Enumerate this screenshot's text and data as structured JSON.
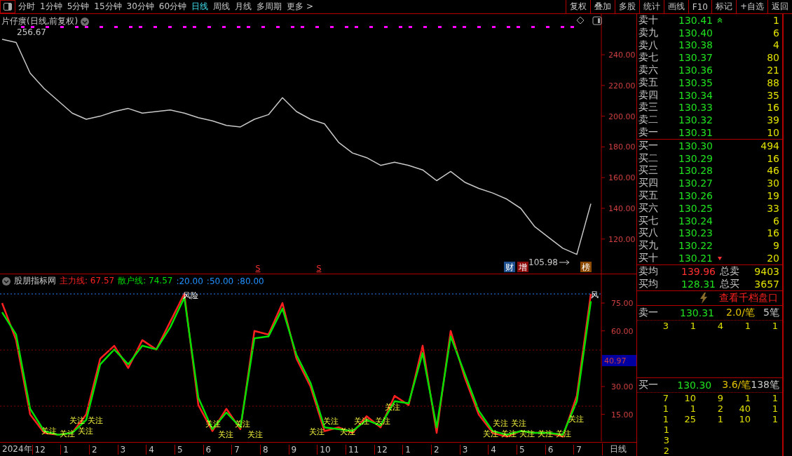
{
  "toolbar": {
    "periods": [
      {
        "label": "分时",
        "selected": false
      },
      {
        "label": "1分钟",
        "selected": false
      },
      {
        "label": "5分钟",
        "selected": false
      },
      {
        "label": "15分钟",
        "selected": false
      },
      {
        "label": "30分钟",
        "selected": false
      },
      {
        "label": "60分钟",
        "selected": false
      },
      {
        "label": "日线",
        "selected": true
      },
      {
        "label": "周线",
        "selected": false
      },
      {
        "label": "月线",
        "selected": false
      },
      {
        "label": "多周期",
        "selected": false
      },
      {
        "label": "更多 >",
        "selected": false
      }
    ],
    "buttons": [
      "复权",
      "叠加",
      "多股",
      "统计",
      "画线",
      "F10",
      "标记",
      "+自选",
      "返回"
    ]
  },
  "price_chart": {
    "title": "片仔癀(日线,前复权)",
    "extremes": [
      "256.67",
      "105.98"
    ],
    "signals": [
      "S",
      "S"
    ],
    "badges": [
      {
        "text": "财",
        "color": "#1e4f8f"
      },
      {
        "text": "增",
        "color": "#8b0a0a"
      },
      {
        "text": "榜",
        "color": "#8b4a00"
      }
    ],
    "chart_data": {
      "type": "line",
      "ylim": [
        97.5,
        266.5
      ],
      "yticks": [
        {
          "value": 240,
          "label": "240.00"
        },
        {
          "value": 220,
          "label": "220.00"
        },
        {
          "value": 200,
          "label": "200.00"
        },
        {
          "value": 180,
          "label": "180.00"
        },
        {
          "value": 160,
          "label": "160.00"
        },
        {
          "value": 140,
          "label": "140.00"
        },
        {
          "value": 120,
          "label": "120.00"
        }
      ],
      "series": [
        {
          "color": "#c8c8c8",
          "values": [
            250,
            248,
            228,
            218,
            210,
            202,
            198,
            200,
            203,
            205,
            202,
            203,
            204,
            202,
            199,
            197,
            194,
            193,
            198,
            201,
            212,
            203,
            198,
            195,
            183,
            176,
            173,
            168,
            170,
            168,
            165,
            158,
            164,
            157,
            153,
            150,
            146,
            140,
            128,
            121,
            114,
            110,
            143
          ]
        }
      ]
    }
  },
  "indicator": {
    "name": "股朋指标网",
    "legend": [
      "主力线: 67.57",
      "散户线: 74.57"
    ],
    "params": [
      ":20.00",
      ":50.00",
      ":80.00"
    ],
    "axis_marker": "40.97",
    "signals": [
      "风险",
      "风",
      "关注",
      "关注",
      "关注",
      "关注",
      "关注",
      "关注",
      "关注",
      "关注",
      "关注",
      "关注",
      "关注",
      "关注",
      "关注",
      "关注",
      "关注",
      "关注",
      "关注",
      "关注",
      "关注",
      "关注",
      "关注",
      "关注",
      "关注"
    ],
    "chart_data": {
      "type": "line",
      "ylim": [
        0.5,
        90.5
      ],
      "yticks": [
        {
          "value": 75,
          "label": "75.00"
        },
        {
          "value": 60,
          "label": "60.00"
        },
        {
          "value": 30,
          "label": "30.00"
        },
        {
          "value": 15,
          "label": "15.00"
        }
      ],
      "series": [
        {
          "color": "#ff2020",
          "values": [
            75,
            55,
            15,
            5,
            4,
            5,
            15,
            45,
            52,
            40,
            55,
            50,
            65,
            80,
            20,
            6,
            18,
            7,
            60,
            58,
            75,
            45,
            30,
            6,
            8,
            5,
            14,
            8,
            25,
            20,
            52,
            5,
            60,
            35,
            15,
            5,
            3,
            6,
            5,
            5,
            3,
            25,
            80
          ]
        },
        {
          "color": "#00e000",
          "values": [
            70,
            58,
            18,
            6,
            4,
            5,
            12,
            42,
            50,
            42,
            52,
            50,
            62,
            78,
            24,
            7,
            16,
            8,
            56,
            57,
            72,
            47,
            32,
            8,
            7,
            6,
            12,
            9,
            22,
            21,
            48,
            8,
            57,
            37,
            17,
            6,
            4,
            6,
            5,
            5,
            4,
            22,
            76
          ]
        }
      ]
    }
  },
  "date_axis": {
    "labels": [
      "2024年",
      "12",
      "1",
      "2",
      "3",
      "4",
      "5",
      "6",
      "7",
      "8",
      "9",
      "10",
      "11",
      "12",
      "1",
      "2",
      "3",
      "4",
      "5",
      "6",
      "7"
    ],
    "period": "日线"
  },
  "order_book": {
    "asks": [
      {
        "label": "卖十",
        "price": "130.41",
        "volume": "1",
        "kind": "top"
      },
      {
        "label": "卖九",
        "price": "130.40",
        "volume": "6",
        "kind": "level"
      },
      {
        "label": "卖八",
        "price": "130.38",
        "volume": "4",
        "kind": "level"
      },
      {
        "label": "卖七",
        "price": "130.37",
        "volume": "80",
        "kind": "level"
      },
      {
        "label": "卖六",
        "price": "130.36",
        "volume": "21",
        "kind": "level"
      },
      {
        "label": "卖五",
        "price": "130.35",
        "volume": "88",
        "kind": "level"
      },
      {
        "label": "卖四",
        "price": "130.34",
        "volume": "35",
        "kind": "level"
      },
      {
        "label": "卖三",
        "price": "130.33",
        "volume": "16",
        "kind": "level"
      },
      {
        "label": "卖二",
        "price": "130.32",
        "volume": "39",
        "kind": "level"
      },
      {
        "label": "卖一",
        "price": "130.31",
        "volume": "10",
        "kind": "level"
      }
    ],
    "bids": [
      {
        "label": "买一",
        "price": "130.30",
        "volume": "494",
        "kind": "level"
      },
      {
        "label": "买二",
        "price": "130.29",
        "volume": "16",
        "kind": "level"
      },
      {
        "label": "买三",
        "price": "130.28",
        "volume": "46",
        "kind": "level"
      },
      {
        "label": "买四",
        "price": "130.27",
        "volume": "30",
        "kind": "level"
      },
      {
        "label": "买五",
        "price": "130.26",
        "volume": "19",
        "kind": "level"
      },
      {
        "label": "买六",
        "price": "130.25",
        "volume": "33",
        "kind": "level"
      },
      {
        "label": "买七",
        "price": "130.24",
        "volume": "6",
        "kind": "level"
      },
      {
        "label": "买八",
        "price": "130.23",
        "volume": "16",
        "kind": "level"
      },
      {
        "label": "买九",
        "price": "130.22",
        "volume": "9",
        "kind": "level"
      },
      {
        "label": "买十",
        "price": "130.21",
        "volume": "20",
        "kind": "bottom"
      }
    ],
    "summary": [
      {
        "label": "卖均",
        "price": "139.96",
        "color": "#ff3030",
        "total_label": "总卖",
        "total": "9403"
      },
      {
        "label": "买均",
        "price": "128.31",
        "color": "#20e020",
        "total_label": "总买",
        "total": "3657"
      }
    ],
    "depth_link": "查看千档盘口",
    "queues": [
      {
        "label": "卖一",
        "price": "130.31",
        "avg": "2.0/笔",
        "count": "5笔",
        "rows": [
          [
            "3",
            "1",
            "4",
            "1",
            "1"
          ]
        ]
      },
      {
        "label": "买一",
        "price": "130.30",
        "avg": "3.6/笔",
        "count": "138笔",
        "rows": [
          [
            "7",
            "10",
            "9",
            "1",
            "1"
          ],
          [
            "1",
            "1",
            "2",
            "40",
            "1"
          ],
          [
            "1",
            "25",
            "1",
            "10",
            "1"
          ],
          [
            "1"
          ],
          [
            "3"
          ],
          [
            "2"
          ]
        ]
      }
    ]
  }
}
